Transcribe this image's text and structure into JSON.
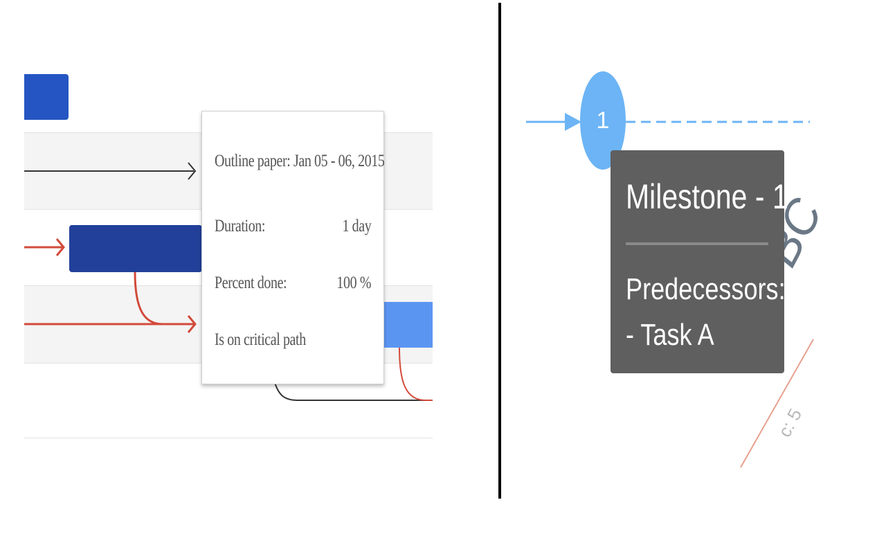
{
  "gantt_tooltip": {
    "title": "Outline paper: Jan 05 - 06, 2015",
    "duration_label": "Duration:",
    "duration_value": "1 day",
    "percent_label": "Percent done:",
    "percent_value": "100 %",
    "critical_text": "Is on critical path"
  },
  "milestone_tooltip": {
    "circle_number": "1",
    "title": "Milestone - 1",
    "predecessors_label": "Predecessors:",
    "predecessor_item": "- Task A"
  },
  "background_task": {
    "label": "Task BC",
    "sub_label": "c: 5"
  },
  "colors": {
    "bar_blue": "#2455c2",
    "bar_dark_blue": "#22409a",
    "bar_light_blue": "#5b95f2",
    "critical_red": "#d24a3a",
    "milestone_blue": "#6cb4f5",
    "tooltip_dark": "#5f5f5f"
  }
}
